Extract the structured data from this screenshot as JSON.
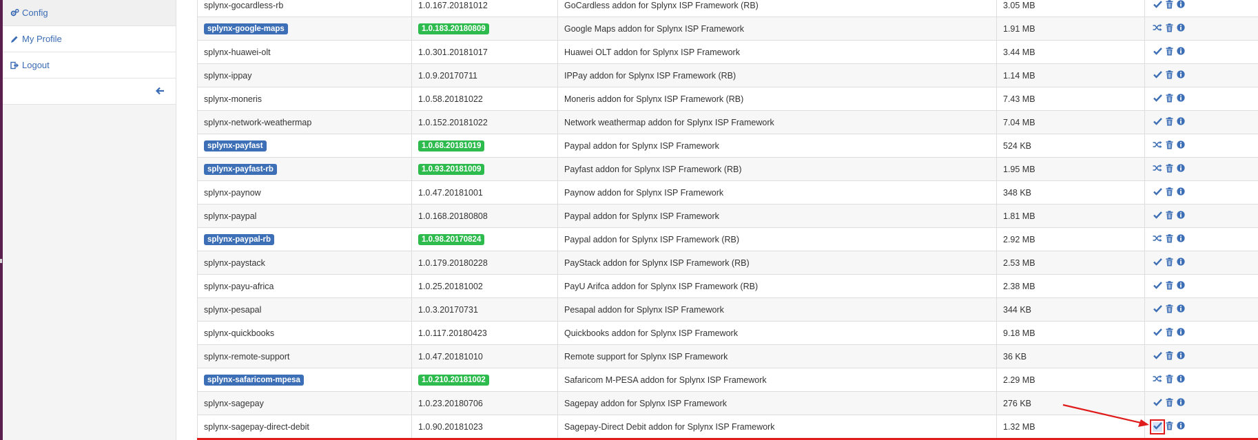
{
  "sidebar": {
    "items": [
      {
        "label": "Config",
        "icon": "cogs-icon"
      },
      {
        "label": "My Profile",
        "icon": "pencil-icon"
      },
      {
        "label": "Logout",
        "icon": "logout-icon"
      }
    ],
    "collapse_icon": "arrow-left-icon"
  },
  "colors": {
    "link": "#3a6bb5",
    "name_badge": "#3d6fb6",
    "version_badge": "#2ebb4e",
    "annotation": "#e01b1b"
  },
  "addons": [
    {
      "name": "splynx-gocardless-rb",
      "version": "1.0.167.20181012",
      "description": "GoCardless addon for Splynx ISP Framework (RB)",
      "size": "3.05 MB",
      "installed": false
    },
    {
      "name": "splynx-google-maps",
      "version": "1.0.183.20180809",
      "description": "Google Maps addon for Splynx ISP Framework",
      "size": "1.91 MB",
      "installed": true
    },
    {
      "name": "splynx-huawei-olt",
      "version": "1.0.301.20181017",
      "description": "Huawei OLT addon for Splynx ISP Framework",
      "size": "3.44 MB",
      "installed": false
    },
    {
      "name": "splynx-ippay",
      "version": "1.0.9.20170711",
      "description": "IPPay addon for Splynx ISP Framework (RB)",
      "size": "1.14 MB",
      "installed": false
    },
    {
      "name": "splynx-moneris",
      "version": "1.0.58.20181022",
      "description": "Moneris addon for Splynx ISP Framework (RB)",
      "size": "7.43 MB",
      "installed": false
    },
    {
      "name": "splynx-network-weathermap",
      "version": "1.0.152.20181022",
      "description": "Network weathermap addon for Splynx ISP Framework",
      "size": "7.04 MB",
      "installed": false
    },
    {
      "name": "splynx-payfast",
      "version": "1.0.68.20181019",
      "description": "Paypal addon for Splynx ISP Framework",
      "size": "524 KB",
      "installed": true
    },
    {
      "name": "splynx-payfast-rb",
      "version": "1.0.93.20181009",
      "description": "Payfast addon for Splynx ISP Framework (RB)",
      "size": "1.95 MB",
      "installed": true
    },
    {
      "name": "splynx-paynow",
      "version": "1.0.47.20181001",
      "description": "Paynow addon for Splynx ISP Framework",
      "size": "348 KB",
      "installed": false
    },
    {
      "name": "splynx-paypal",
      "version": "1.0.168.20180808",
      "description": "Paypal addon for Splynx ISP Framework",
      "size": "1.81 MB",
      "installed": false
    },
    {
      "name": "splynx-paypal-rb",
      "version": "1.0.98.20170824",
      "description": "Paypal addon for Splynx ISP Framework (RB)",
      "size": "2.92 MB",
      "installed": true
    },
    {
      "name": "splynx-paystack",
      "version": "1.0.179.20180228",
      "description": "PayStack addon for Splynx ISP Framework (RB)",
      "size": "2.53 MB",
      "installed": false
    },
    {
      "name": "splynx-payu-africa",
      "version": "1.0.25.20181002",
      "description": "PayU Arifca addon for Splynx ISP Framework (RB)",
      "size": "2.38 MB",
      "installed": false
    },
    {
      "name": "splynx-pesapal",
      "version": "1.0.3.20170731",
      "description": "Pesapal addon for Splynx ISP Framework",
      "size": "344 KB",
      "installed": false
    },
    {
      "name": "splynx-quickbooks",
      "version": "1.0.117.20180423",
      "description": "Quickbooks addon for Splynx ISP Framework",
      "size": "9.18 MB",
      "installed": false
    },
    {
      "name": "splynx-remote-support",
      "version": "1.0.47.20181010",
      "description": "Remote support for Splynx ISP Framework",
      "size": "36 KB",
      "installed": false
    },
    {
      "name": "splynx-safaricom-mpesa",
      "version": "1.0.210.20181002",
      "description": "Safaricom M-PESA addon for Splynx ISP Framework",
      "size": "2.29 MB",
      "installed": true
    },
    {
      "name": "splynx-sagepay",
      "version": "1.0.23.20180706",
      "description": "Sagepay addon for Splynx ISP Framework",
      "size": "276 KB",
      "installed": false
    },
    {
      "name": "splynx-sagepay-direct-debit",
      "version": "1.0.90.20181023",
      "description": "Sagepay-Direct Debit addon for Splynx ISP Framework",
      "size": "1.32 MB",
      "installed": false,
      "highlighted": true
    }
  ],
  "action_icons": {
    "install": "check-icon",
    "reinstall": "shuffle-icon",
    "delete": "trash-icon",
    "info": "info-icon"
  }
}
